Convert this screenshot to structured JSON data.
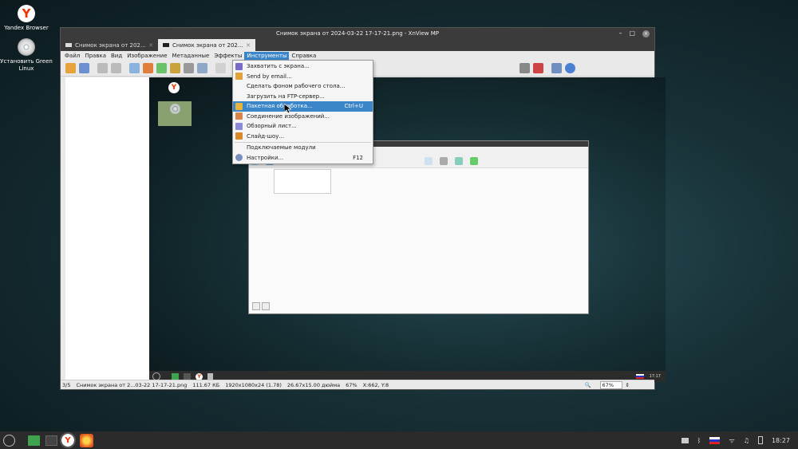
{
  "desktop": {
    "icons": [
      {
        "label": "Yandex Browser"
      },
      {
        "label": "Установить Green Linux"
      }
    ]
  },
  "window": {
    "title": "Снимок экрана от 2024-03-22 17-17-21.png - XnView MP",
    "tabs": [
      {
        "label": "Снимок экрана от 202..."
      },
      {
        "label": "Снимок экрана от 202..."
      }
    ],
    "menu": [
      "Файл",
      "Правка",
      "Вид",
      "Изображение",
      "Метаданные",
      "Эффекты",
      "Инструменты",
      "Справка"
    ],
    "status": {
      "index": "3/5",
      "file": "Снимок экрана от 2...03-22 17-17-21.png",
      "size": "111.67 КБ",
      "dims": "1920x1080x24 (1.78)",
      "inches": "26.67x15.00 дюйма",
      "zoom_pct": "67%",
      "coords": "X:662, Y:8",
      "zoom_field": "67%"
    }
  },
  "tools_menu": {
    "items": [
      {
        "label": "Захватить с экрана...",
        "icon": "camera-icon",
        "shortcut": ""
      },
      {
        "label": "Send by email...",
        "icon": "mail-icon",
        "shortcut": ""
      },
      {
        "label": "Сделать фоном рабочего стола...",
        "icon": "",
        "shortcut": ""
      },
      {
        "label": "Загрузить на FTP-сервер...",
        "icon": "",
        "shortcut": ""
      },
      {
        "label": "Пакетная обработка...",
        "icon": "batch-icon",
        "shortcut": "Ctrl+U",
        "selected": true
      },
      {
        "label": "Соединение изображений...",
        "icon": "join-icon",
        "shortcut": ""
      },
      {
        "label": "Обзорный лист...",
        "icon": "contact-sheet-icon",
        "shortcut": ""
      },
      {
        "label": "Слайд-шоу...",
        "icon": "slideshow-icon",
        "shortcut": ""
      },
      {
        "label": "Подключаемые модули",
        "icon": "",
        "shortcut": "",
        "sep_before": true
      },
      {
        "label": "Настройки...",
        "icon": "settings-icon",
        "shortcut": "F12"
      }
    ]
  },
  "taskbar": {
    "clock": "18:27",
    "inner_clock": "17:17"
  },
  "colors": {
    "accent": "#3a86c8"
  }
}
